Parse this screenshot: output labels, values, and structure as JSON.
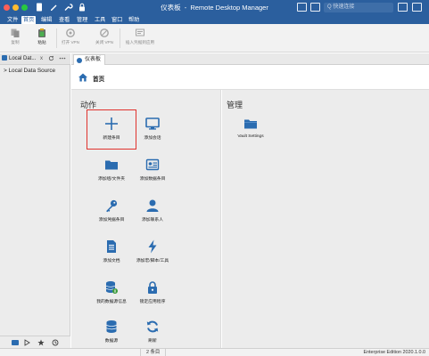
{
  "window": {
    "title_left": "仪表板",
    "title_sep": "-",
    "title_right": "Remote Desktop Manager",
    "search_placeholder": "Q 快速连接"
  },
  "menubar": {
    "items": [
      {
        "label": "文件",
        "active": false
      },
      {
        "label": "首页",
        "active": true
      },
      {
        "label": "编辑",
        "active": false
      },
      {
        "label": "查看",
        "active": false
      },
      {
        "label": "管理",
        "active": false
      },
      {
        "label": "工具",
        "active": false
      },
      {
        "label": "窗口",
        "active": false
      },
      {
        "label": "帮助",
        "active": false
      }
    ]
  },
  "ribbon": {
    "buttons": [
      {
        "label": "复制",
        "icon": "copy-icon",
        "enabled": false
      },
      {
        "label": "粘贴",
        "icon": "paste-icon",
        "enabled": true
      },
      {
        "label": "打开 VPN",
        "icon": "open-vpn-icon",
        "enabled": false
      },
      {
        "label": "关闭 VPN",
        "icon": "close-vpn-icon",
        "enabled": false
      },
      {
        "label": "插入凭据到应用",
        "icon": "insert-credentials-icon",
        "enabled": false
      }
    ]
  },
  "sidebar": {
    "tab_label": "Local Dat...",
    "tab_close": "x",
    "tree_root": "> Local Data Source",
    "bottom_icons": [
      "folder-icon",
      "play-icon",
      "star-icon",
      "history-icon"
    ]
  },
  "main": {
    "tab_label": "仪表板",
    "home_title": "首页",
    "actions_title": "动作",
    "manage_title": "管理",
    "actions": [
      {
        "label": "新建条目",
        "icon": "plus-icon",
        "highlighted": true
      },
      {
        "label": "添加会话",
        "icon": "monitor-icon",
        "highlighted": false
      },
      {
        "label": "添加组/文件夹",
        "icon": "folder-icon",
        "highlighted": false
      },
      {
        "label": "添加数据条目",
        "icon": "data-entry-icon",
        "highlighted": false
      },
      {
        "label": "添加凭据条目",
        "icon": "key-icon",
        "highlighted": false
      },
      {
        "label": "添加联系人",
        "icon": "contact-icon",
        "highlighted": false
      },
      {
        "label": "添加文档",
        "icon": "document-icon",
        "highlighted": false
      },
      {
        "label": "添加宏/脚本/工具",
        "icon": "macro-script-icon",
        "highlighted": false
      },
      {
        "label": "我的数据源信息",
        "icon": "datasource-info-icon",
        "highlighted": false
      },
      {
        "label": "锁定应用程序",
        "icon": "lock-icon",
        "highlighted": false
      },
      {
        "label": "数据源",
        "icon": "datasource-icon",
        "highlighted": false
      },
      {
        "label": "刷新",
        "icon": "refresh-icon",
        "highlighted": false
      }
    ],
    "manage": [
      {
        "label": "Vault Settings",
        "icon": "vault-folder-icon"
      }
    ]
  },
  "statusbar": {
    "count": "2 条目",
    "edition": "Enterprise Edition 2020.1.0.0"
  },
  "colors": {
    "title_blue": "#2b5f9e",
    "icon_blue": "#2b6cb0",
    "highlight_red": "#e0322d"
  }
}
